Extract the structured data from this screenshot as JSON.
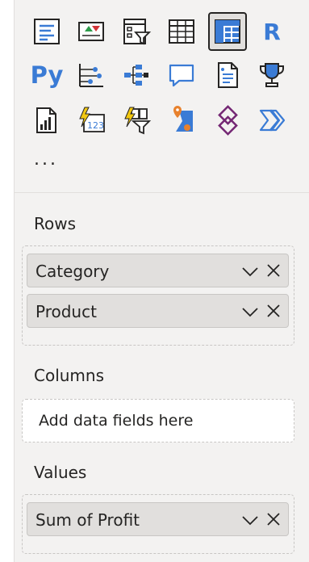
{
  "visualizations": {
    "python_label": "Py",
    "r_label": "R",
    "card_label": "123",
    "more": "..."
  },
  "rows": {
    "label": "Rows",
    "fields": [
      "Category",
      "Product"
    ]
  },
  "columns": {
    "label": "Columns",
    "placeholder": "Add data fields here"
  },
  "values": {
    "label": "Values",
    "fields": [
      "Sum of Profit"
    ]
  },
  "colors": {
    "accent_blue": "#3a7bd5",
    "selected_border": "#252423",
    "pill_bg": "#e1dfdd",
    "pane_bg": "#f3f2f1"
  }
}
